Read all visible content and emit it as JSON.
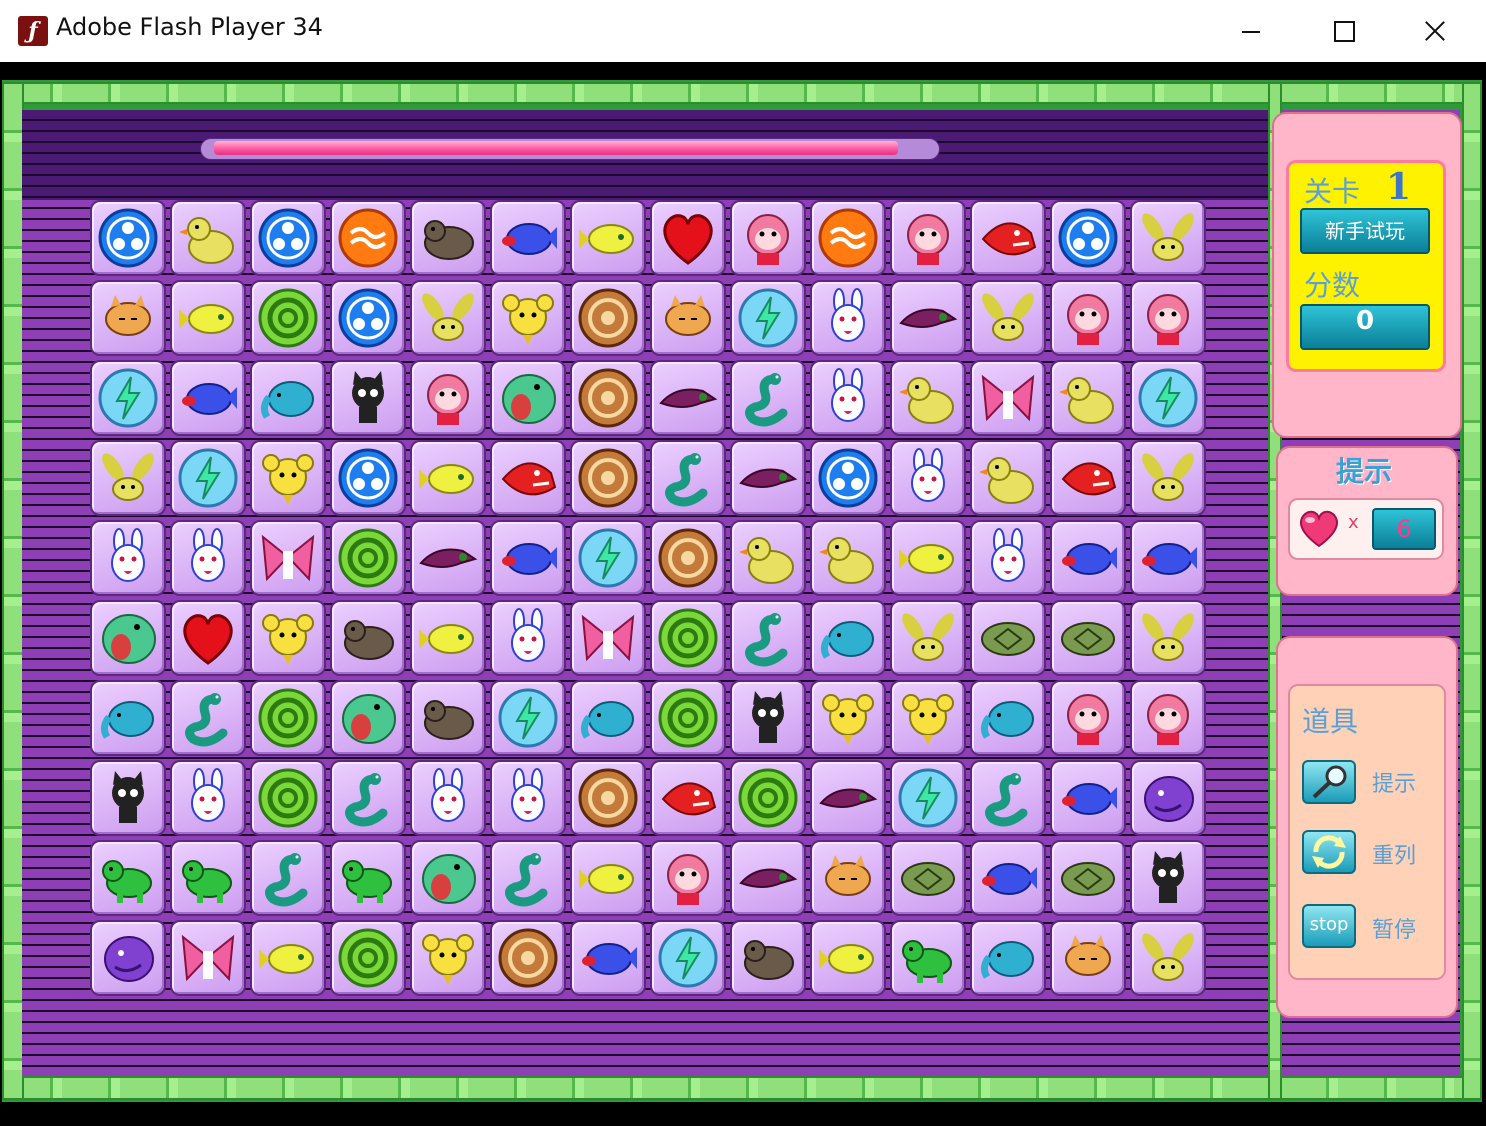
{
  "window": {
    "title": "Adobe Flash Player 34",
    "icon": "flash-f-icon"
  },
  "timer": {
    "remaining_fraction": 0.96
  },
  "board": {
    "rows": [
      [
        "blue-swirl",
        "duck",
        "blue-swirl",
        "orange-swirl",
        "gray-bear",
        "blue-fish",
        "yellow-fish",
        "heart",
        "monkey",
        "orange-swirl",
        "monkey",
        "red-fish",
        "blue-swirl",
        "banana-rabbit"
      ],
      [
        "orange-cat",
        "yellow-fish",
        "green-ring",
        "blue-swirl",
        "banana-rabbit",
        "yellow-mouse",
        "brown-swirl",
        "orange-cat",
        "lightning",
        "white-rabbit",
        "purple-bird",
        "banana-rabbit",
        "monkey",
        "monkey"
      ],
      [
        "lightning",
        "blue-fish",
        "blue-elephant",
        "black-cat",
        "monkey",
        "green-frog",
        "brown-swirl",
        "purple-bird",
        "teal-snake",
        "white-rabbit",
        "duck",
        "pink-bow",
        "duck",
        "lightning"
      ],
      [
        "banana-rabbit",
        "lightning",
        "yellow-mouse",
        "blue-swirl",
        "yellow-fish",
        "red-fish",
        "brown-swirl",
        "teal-snake",
        "purple-bird",
        "blue-swirl",
        "white-rabbit",
        "duck",
        "red-fish",
        "banana-rabbit"
      ],
      [
        "white-rabbit",
        "white-rabbit",
        "pink-bow",
        "green-ring",
        "purple-bird",
        "blue-fish",
        "lightning",
        "brown-swirl",
        "duck",
        "duck",
        "yellow-fish",
        "white-rabbit",
        "blue-fish",
        "blue-fish"
      ],
      [
        "green-frog",
        "heart",
        "yellow-mouse",
        "gray-bear",
        "yellow-fish",
        "white-rabbit",
        "pink-bow",
        "green-ring",
        "teal-snake",
        "blue-elephant",
        "banana-rabbit",
        "turtle",
        "turtle",
        "banana-rabbit"
      ],
      [
        "blue-elephant",
        "teal-snake",
        "green-ring",
        "green-frog",
        "gray-bear",
        "lightning",
        "blue-elephant",
        "green-ring",
        "black-cat",
        "yellow-mouse",
        "yellow-mouse",
        "blue-elephant",
        "monkey",
        "monkey"
      ],
      [
        "black-cat",
        "white-rabbit",
        "green-ring",
        "teal-snake",
        "white-rabbit",
        "white-rabbit",
        "brown-swirl",
        "red-fish",
        "green-ring",
        "purple-bird",
        "lightning",
        "teal-snake",
        "blue-fish",
        "purple-blob"
      ],
      [
        "green-dino",
        "green-dino",
        "teal-snake",
        "green-dino",
        "green-frog",
        "teal-snake",
        "yellow-fish",
        "monkey",
        "purple-bird",
        "orange-cat",
        "turtle",
        "blue-fish",
        "turtle",
        "black-cat"
      ],
      [
        "purple-blob",
        "pink-bow",
        "yellow-fish",
        "green-ring",
        "yellow-mouse",
        "brown-swirl",
        "blue-fish",
        "lightning",
        "gray-bear",
        "yellow-fish",
        "green-dino",
        "blue-elephant",
        "orange-cat",
        "banana-rabbit"
      ]
    ]
  },
  "sidebar": {
    "level_label": "关卡",
    "level_value": "1",
    "mode_button": "新手试玩",
    "score_label": "分数",
    "score_value": "0",
    "hint_title": "提示",
    "hint_icon": "heart-icon",
    "hint_times": "x",
    "hint_count": "6",
    "items_title": "道具",
    "items": [
      {
        "icon": "magnifier-icon",
        "label": "提示"
      },
      {
        "icon": "refresh-icon",
        "label": "重列"
      },
      {
        "icon": "stop-icon",
        "icon_text": "stop",
        "label": "暂停"
      }
    ]
  },
  "colors": {
    "tile_bg": "#d8b0f6",
    "board_bg": "#8f3fb6",
    "frame_green": "#8fe07a",
    "panel_pink": "#ffb6c8",
    "score_box": "#fff200"
  }
}
